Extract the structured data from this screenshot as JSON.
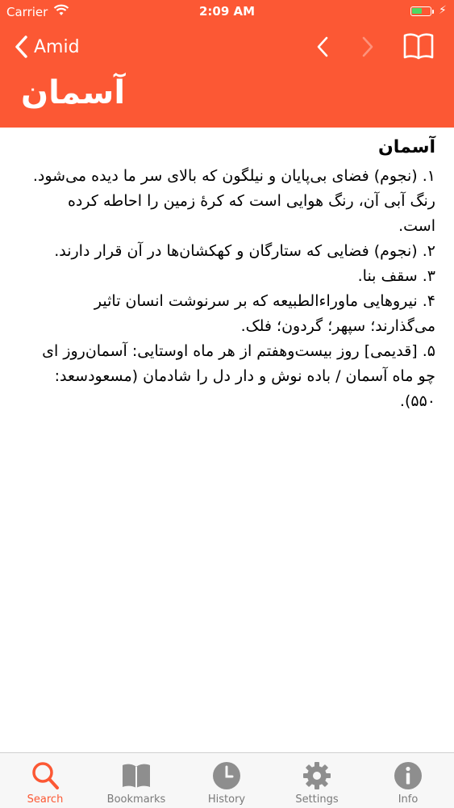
{
  "status_bar": {
    "carrier": "Carrier",
    "time": "2:09 AM",
    "battery_color": "#4cd964"
  },
  "nav": {
    "back_label": "Amid",
    "title": "آسمان",
    "icons": [
      "chevron-left-icon",
      "prev-icon",
      "next-icon",
      "book-icon"
    ]
  },
  "entry": {
    "headword": "آسمان",
    "definitions": [
      "۱. (نجوم) فضای بی‌پایان و نیلگون که بالای سر ما دیده می‌شود. رنگ آبی آن، رنگ هوایی است که کرهٔ زمین را احاطه کرده است.",
      "۲. (نجوم) فضایی که ستارگان و کهکشان‌ها در آن قرار دارند.",
      "۳. سقف بنا.",
      "۴. نیروهایی ماوراءالطبیعه که بر سرنوشت انسان تاثیر می‌گذارند؛ سپهر؛ گردون؛ فلک.",
      "۵. [قدیمی] روز بیست‌وهفتم از هر ماه اوستایی: آسمان‌روز ای چو ماه آسمان / باده نوش و دار دل را شادمان (مسعودسعد: ۵۵۰)."
    ]
  },
  "tabs": [
    {
      "label": "Search",
      "icon": "search-icon",
      "active": true
    },
    {
      "label": "Bookmarks",
      "icon": "bookmarks-icon",
      "active": false
    },
    {
      "label": "History",
      "icon": "history-icon",
      "active": false
    },
    {
      "label": "Settings",
      "icon": "settings-icon",
      "active": false
    },
    {
      "label": "Info",
      "icon": "info-icon",
      "active": false
    }
  ],
  "colors": {
    "accent": "#fc5834",
    "tab_inactive": "#7a7a7a",
    "tab_bar_bg": "#f7f7f7"
  }
}
